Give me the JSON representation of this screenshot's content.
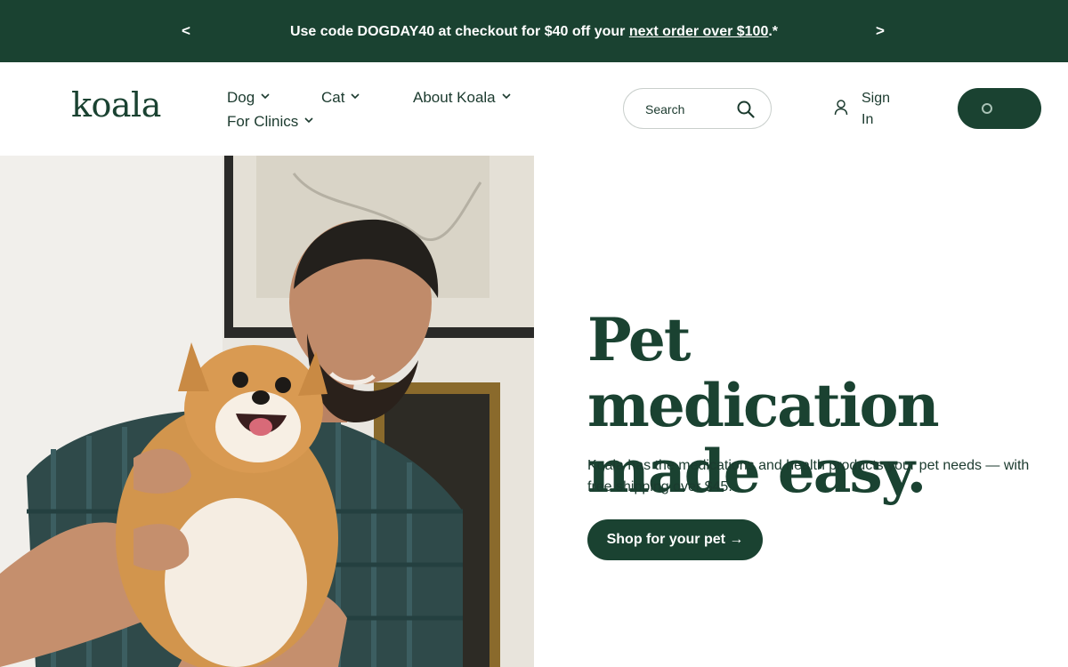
{
  "colors": {
    "brand_green": "#1a4231",
    "text": "#1b3a2e",
    "background": "#ffffff"
  },
  "promo": {
    "prev_label": "<",
    "next_label": ">",
    "text_before_link": "Use code DOGDAY40 at checkout for $40 off your ",
    "link_text": "next order over $100",
    "text_after_link": ".*"
  },
  "header": {
    "logo": "koala",
    "nav": {
      "dog": "Dog",
      "cat": "Cat",
      "about": "About Koala",
      "clinics": "For Clinics"
    },
    "search": {
      "placeholder": "Search",
      "icon": "search-icon"
    },
    "signin": {
      "label": "Sign In",
      "icon": "user-icon"
    },
    "cart": {
      "icon": "loading-spinner-icon"
    }
  },
  "hero": {
    "title_line1": "Pet medication",
    "title_line2": "made easy.",
    "description": "Koala has the medications and health products your pet needs — with free shipping over $45.",
    "cta_label": "Shop for your pet →"
  }
}
